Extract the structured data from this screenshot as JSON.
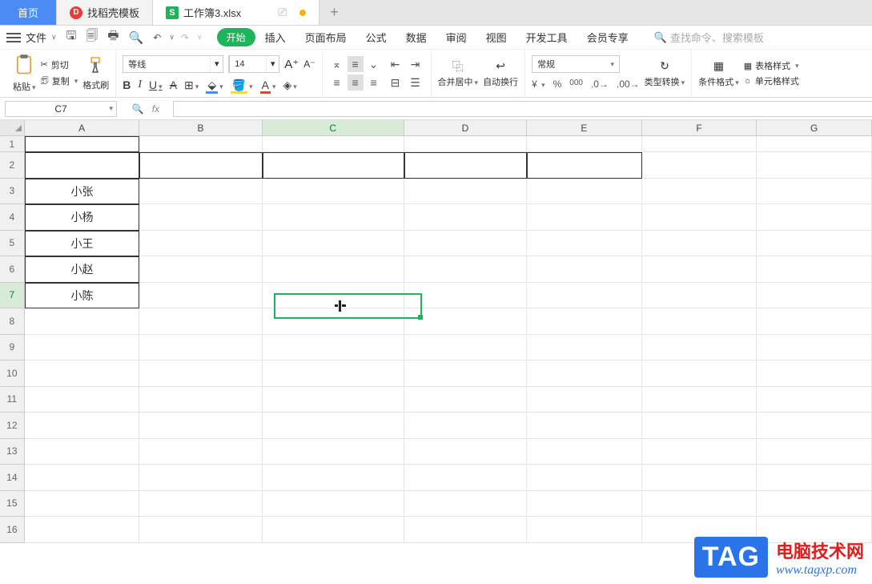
{
  "tabs": {
    "home": "首页",
    "doke": "找稻壳模板",
    "file": "工作簿3.xlsx"
  },
  "menubar": {
    "file": "文件",
    "items": [
      "开始",
      "插入",
      "页面布局",
      "公式",
      "数据",
      "审阅",
      "视图",
      "开发工具",
      "会员专享"
    ],
    "search_placeholder": "查找命令、搜索模板"
  },
  "ribbon": {
    "paste": "粘贴",
    "cut": "剪切",
    "copy": "复制",
    "format_painter": "格式刷",
    "font_name": "等线",
    "font_size": "14",
    "A_plus": "A⁺",
    "A_minus": "A⁻",
    "merge_center": "合并居中",
    "auto_wrap": "自动换行",
    "number_format": "常规",
    "type_convert": "类型转换",
    "cond_format": "条件格式",
    "table_style": "表格样式",
    "cell_style": "单元格样式"
  },
  "namebox": "C7",
  "columns": [
    "A",
    "B",
    "C",
    "D",
    "E",
    "F",
    "G"
  ],
  "rows_labels": [
    "1",
    "2",
    "3",
    "4",
    "5",
    "6",
    "7",
    "8",
    "9",
    "10",
    "11",
    "12",
    "13",
    "14",
    "15",
    "16"
  ],
  "data": {
    "A3": "小张",
    "A4": "小杨",
    "A5": "小王",
    "A6": "小赵",
    "A7": "小陈"
  },
  "selected_cell": "C7",
  "watermark": {
    "tag": "TAG",
    "cn": "电脑技术网",
    "url": "www.tagxp.com"
  }
}
